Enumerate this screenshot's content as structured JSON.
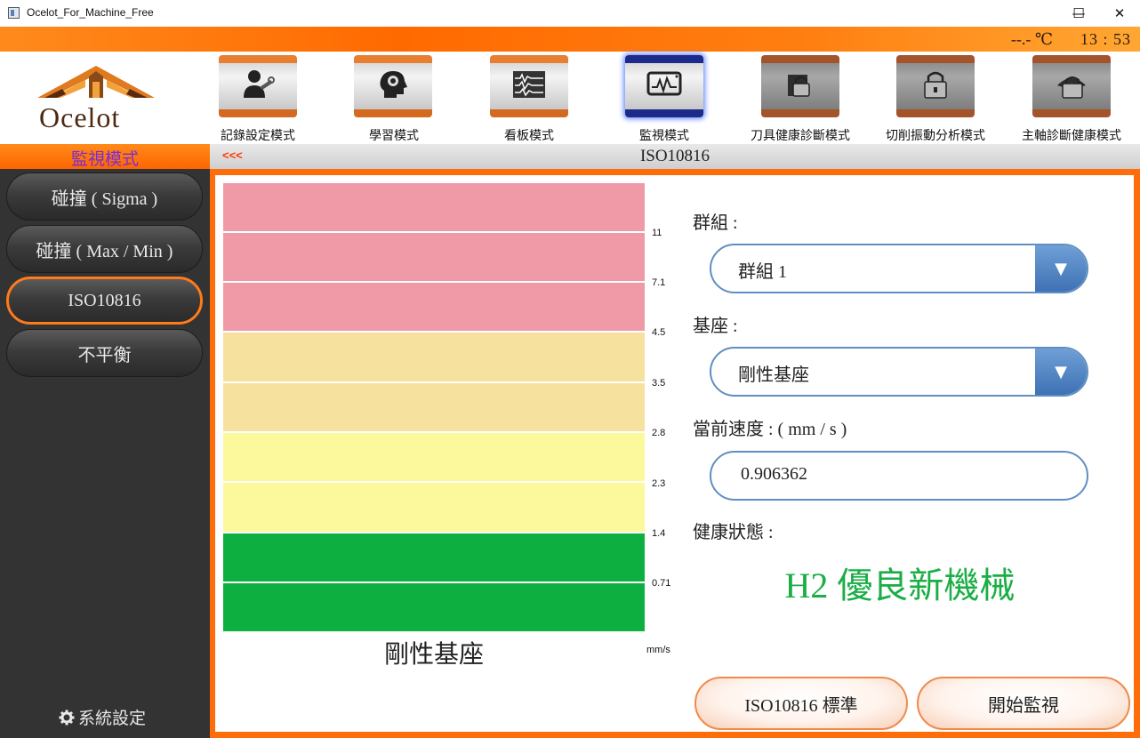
{
  "window": {
    "title": "Ocelot_For_Machine_Free",
    "controls": [
      "—",
      "☐",
      "✕"
    ]
  },
  "status": {
    "temperature": "--.- ℃",
    "clock": "13 : 53"
  },
  "logo": {
    "text": "Ocelot"
  },
  "toolbar": [
    {
      "label": "記錄設定模式",
      "icon": "user-wrench-icon"
    },
    {
      "label": "學習模式",
      "icon": "brain-gear-icon"
    },
    {
      "label": "看板模式",
      "icon": "waveform-board-icon"
    },
    {
      "label": "監視模式",
      "icon": "monitor-wave-icon",
      "active": true
    },
    {
      "label": "刀具健康診斷模式",
      "icon": "locked-tool-icon",
      "locked": true
    },
    {
      "label": "切削振動分析模式",
      "icon": "locked-vibration-icon",
      "locked": true
    },
    {
      "label": "主軸診斷健康模式",
      "icon": "locked-spindle-icon",
      "locked": true
    }
  ],
  "mode": {
    "title": "監視模式"
  },
  "subheader": {
    "back": "<<<",
    "title": "ISO10816"
  },
  "sidebar": {
    "items": [
      {
        "label": "碰撞 ( Sigma )"
      },
      {
        "label": "碰撞 ( Max / Min )"
      },
      {
        "label": "ISO10816",
        "active": true
      },
      {
        "label": "不平衡"
      }
    ],
    "settings_label": "系統設定"
  },
  "chart_data": {
    "type": "bar",
    "title": "",
    "caption": "剛性基座",
    "unit": "mm/s",
    "y_ticks": [
      "11",
      "7.1",
      "4.5",
      "3.5",
      "2.8",
      "2.3",
      "1.4",
      "0.71"
    ],
    "zones": [
      {
        "color": "#f09aa8"
      },
      {
        "color": "#f09aa8"
      },
      {
        "color": "#f09aa8"
      },
      {
        "color": "#f7e19e"
      },
      {
        "color": "#f7e19e"
      },
      {
        "color": "#fcf89c"
      },
      {
        "color": "#fcf89c"
      },
      {
        "color": "#0db040"
      },
      {
        "color": "#0db040"
      }
    ]
  },
  "form": {
    "group_label": "群組 :",
    "group_value": "群組 1",
    "base_label": "基座 :",
    "base_value": "剛性基座",
    "speed_label": "當前速度 : ( mm / s )",
    "speed_value": "0.906362",
    "health_label": "健康狀態 :",
    "health_value": "H2 優良新機械",
    "health_color": "#1aae45"
  },
  "actions": {
    "standard_button": "ISO10816 標準",
    "start_button": "開始監視"
  },
  "colors": {
    "accent_orange": "#ff6c0a",
    "sidebar_bg": "#333333",
    "select_border": "#5f8fc2"
  }
}
